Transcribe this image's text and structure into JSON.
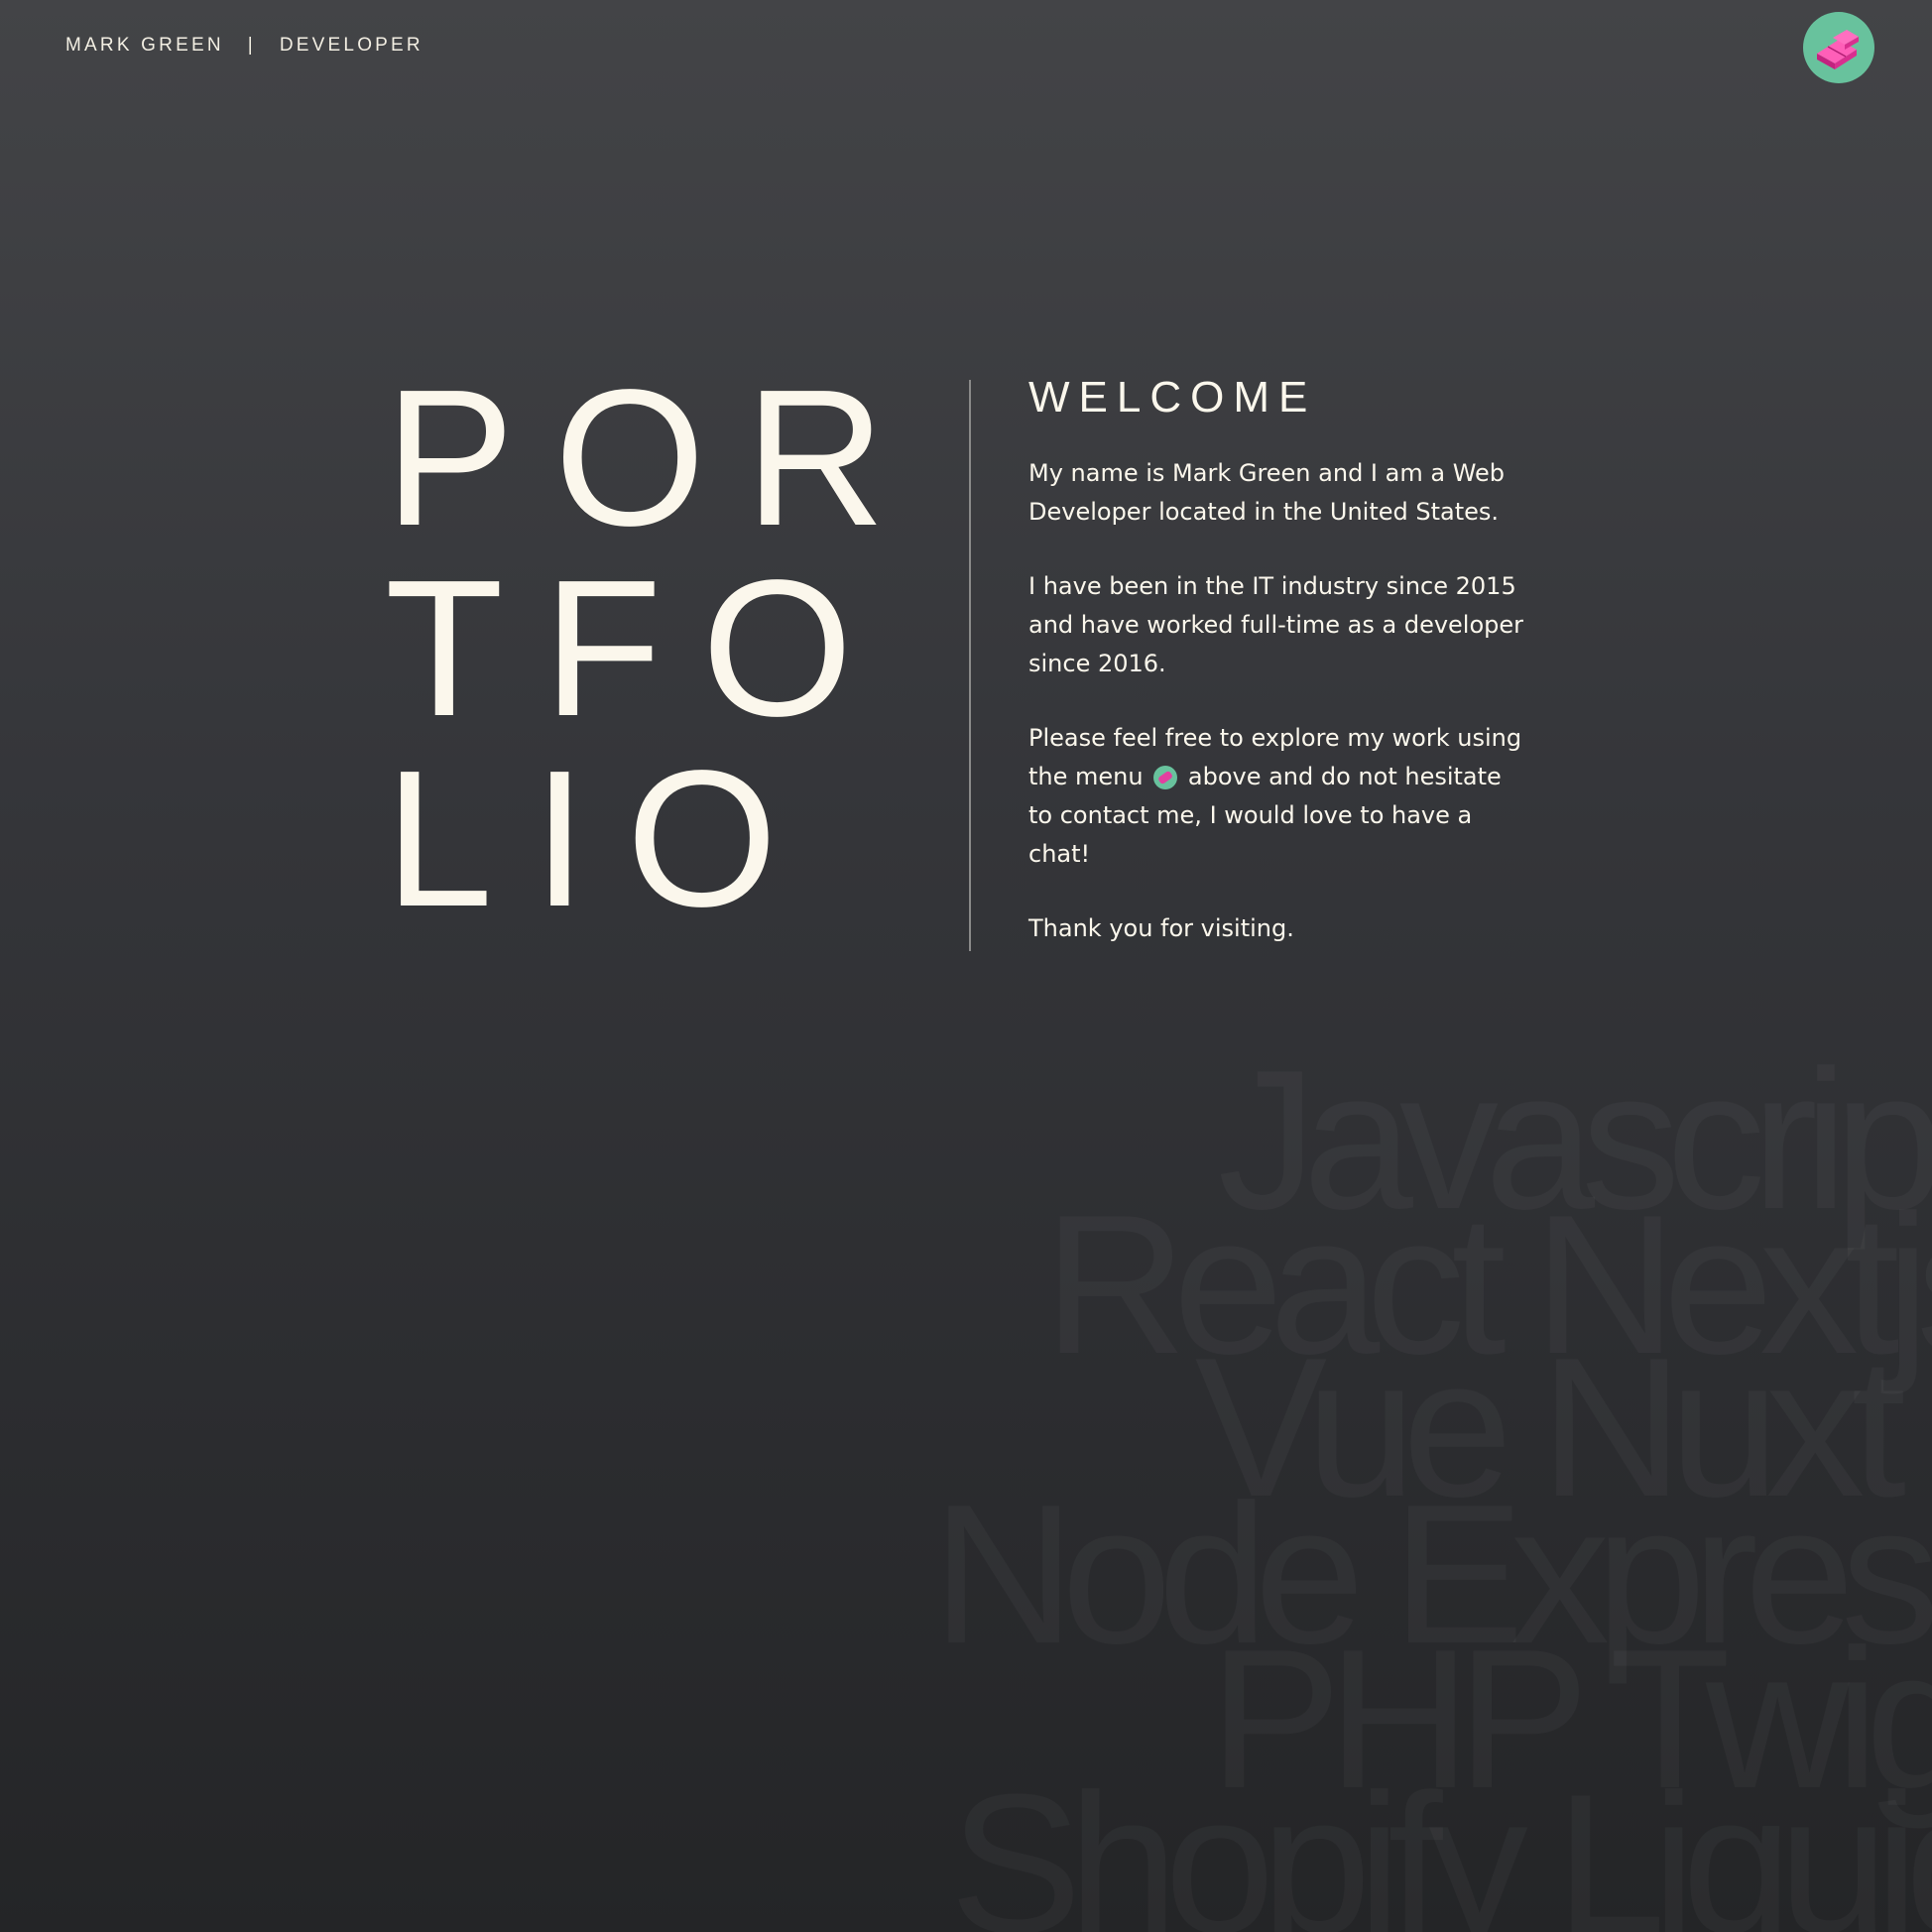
{
  "header": {
    "name": "MARK GREEN",
    "separator": "|",
    "role": "DEVELOPER",
    "menu_icon": "keycap-icon"
  },
  "hero": {
    "title_lines": [
      "POR",
      "TFO",
      "LIO"
    ]
  },
  "intro": {
    "heading": "WELCOME",
    "paragraph1": "My name is Mark Green and I am a Web Developer located in the United States.",
    "paragraph2": "I have been in the IT industry since 2015 and have worked full-time as a developer since 2016.",
    "paragraph3_before": "Please feel free to explore my work using the menu",
    "paragraph3_after": "above and do not hesitate to contact me, I would love to have a chat!",
    "paragraph4": "Thank you for visiting."
  },
  "tech": [
    "Javascript",
    "React Nextjs",
    "Vue Nuxt",
    "Node Express",
    "PHP Twig",
    "Shopify Liquid"
  ],
  "colors": {
    "accent_green": "#68c29d",
    "accent_pink": "#e33fa0",
    "text": "#fbf7ec"
  }
}
